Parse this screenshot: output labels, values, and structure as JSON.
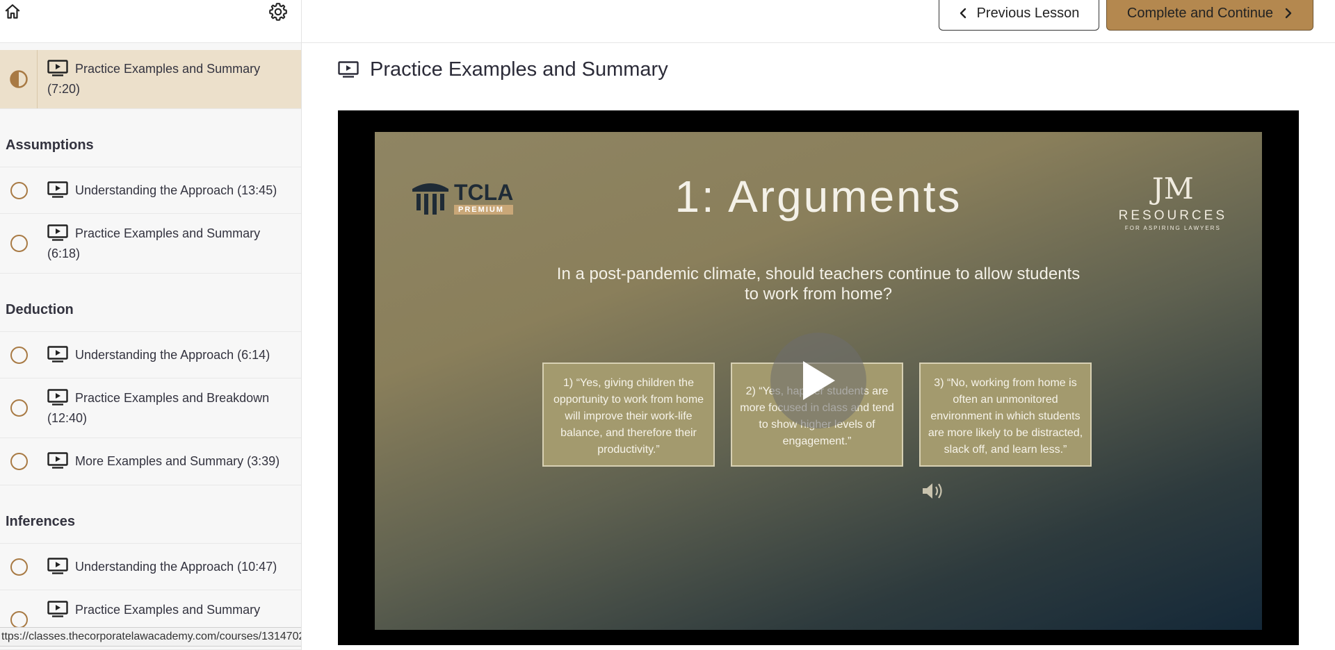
{
  "sidebar": {
    "active_lesson": {
      "label": "Practice Examples and Summary (7:20)"
    },
    "sections": [
      {
        "title": "Assumptions",
        "lessons": [
          {
            "label": "Understanding the Approach (13:45)"
          },
          {
            "label": "Practice Examples and Summary (6:18)"
          }
        ]
      },
      {
        "title": "Deduction",
        "lessons": [
          {
            "label": "Understanding the Approach (6:14)"
          },
          {
            "label": "Practice Examples and Breakdown (12:40)"
          },
          {
            "label": "More Examples and Summary (3:39)"
          }
        ]
      },
      {
        "title": "Inferences",
        "lessons": [
          {
            "label": "Understanding the Approach (10:47)"
          },
          {
            "label": "Practice Examples and Summary"
          }
        ]
      }
    ]
  },
  "status_bar": {
    "url": "ttps://classes.thecorporatelawacademy.com/courses/1314702"
  },
  "header": {
    "previous_label": "Previous Lesson",
    "complete_label": "Complete and Continue"
  },
  "lesson": {
    "title": "Practice Examples and Summary"
  },
  "video": {
    "slide_title": "1: Arguments",
    "question": "In a post-pandemic climate, should teachers continue to allow students to work from home?",
    "arguments": [
      "1) “Yes, giving children the opportunity to work from home will improve their work-life balance, and therefore their productivity.”",
      "2) “Yes, happier students are more focused in class and tend to show higher levels of engagement.”",
      "3) “No, working from home is often an unmonitored environment in which students are more likely to be distracted, slack off, and learn less.”"
    ],
    "logo_left": {
      "name": "TCLA",
      "badge": "PREMIUM"
    },
    "logo_right": {
      "mark": "JM",
      "name": "RESOURCES",
      "tagline": "FOR ASPIRING LAWYERS"
    }
  },
  "colors": {
    "accent": "#b4884f",
    "active_row": "#ece0cb",
    "status_ring": "#a87a44"
  },
  "icons": {
    "home": "home-icon",
    "settings": "gear-icon",
    "lesson_type": "video-lesson-icon",
    "play": "play-icon",
    "volume": "volume-icon"
  }
}
